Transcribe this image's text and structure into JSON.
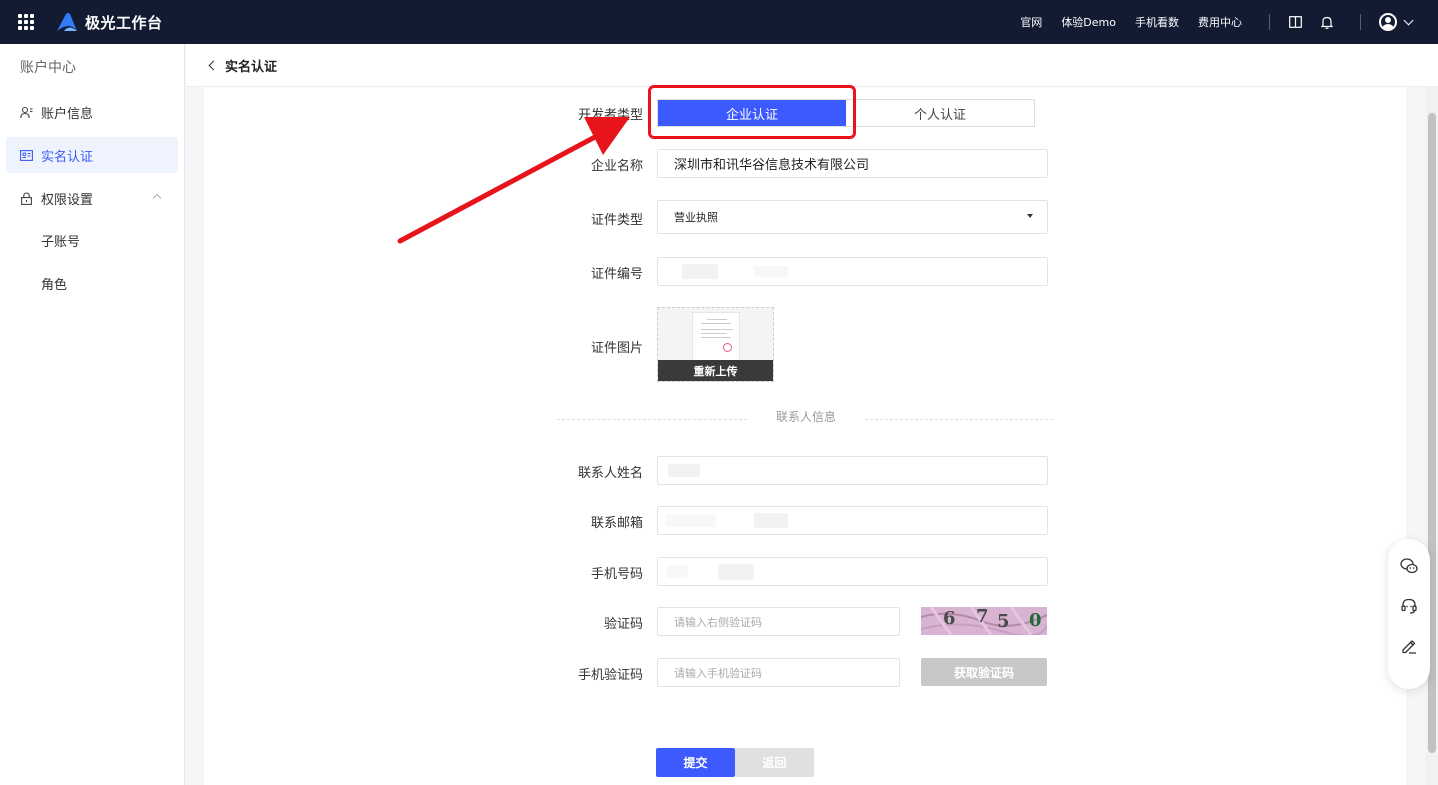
{
  "topbar": {
    "brand": "极光工作台",
    "nav": [
      "官网",
      "体验Demo",
      "手机看数",
      "费用中心"
    ]
  },
  "sidebar": {
    "title": "账户中心",
    "items": [
      {
        "label": "账户信息",
        "icon": "user-info-icon"
      },
      {
        "label": "实名认证",
        "icon": "id-card-icon"
      },
      {
        "label": "权限设置",
        "icon": "lock-icon"
      },
      {
        "label": "子账号"
      },
      {
        "label": "角色"
      }
    ]
  },
  "header": {
    "title": "实名认证"
  },
  "form": {
    "developer_type_label": "开发者类型",
    "developer_type_options": [
      "企业认证",
      "个人认证"
    ],
    "company_name_label": "企业名称",
    "company_name_value": "深圳市和讯华谷信息技术有限公司",
    "cert_type_label": "证件类型",
    "cert_type_value": "营业执照",
    "cert_number_label": "证件编号",
    "cert_image_label": "证件图片",
    "reupload_label": "重新上传",
    "contact_section_title": "联系人信息",
    "contact_name_label": "联系人姓名",
    "contact_email_label": "联系邮箱",
    "phone_label": "手机号码",
    "captcha_label": "验证码",
    "captcha_placeholder": "请输入右侧验证码",
    "captcha_text": "6750",
    "sms_label": "手机验证码",
    "sms_placeholder": "请输入手机验证码",
    "get_code_label": "获取验证码",
    "submit_label": "提交",
    "back_label": "返回"
  },
  "colors": {
    "topbar_bg": "#131b33",
    "primary": "#3d5afe",
    "annotation": "#e8141c"
  }
}
